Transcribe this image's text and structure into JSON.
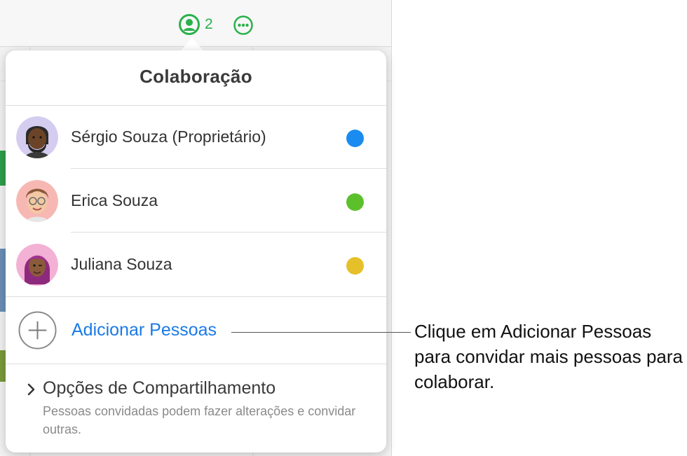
{
  "toolbar": {
    "collaborators_count": "2",
    "collaborate_icon": "person-circle-icon",
    "more_icon": "ellipsis-circle-icon",
    "accent_color": "#2bb14c"
  },
  "popover": {
    "title": "Colaboração",
    "people": [
      {
        "name": "Sérgio Souza (Proprietário)",
        "color": "#1a8cf0",
        "avatar": "memoji-dark-beard"
      },
      {
        "name": "Erica Souza",
        "color": "#5cc02c",
        "avatar": "memoji-glasses"
      },
      {
        "name": "Juliana Souza",
        "color": "#e6c02a",
        "avatar": "memoji-purple-hair"
      }
    ],
    "add_people_label": "Adicionar Pessoas",
    "options": {
      "title": "Opções de Compartilhamento",
      "description": "Pessoas convidadas podem fazer alterações e convidar outras."
    }
  },
  "callout": {
    "text": "Clique em Adicionar Pessoas para convidar mais pessoas para colaborar."
  }
}
